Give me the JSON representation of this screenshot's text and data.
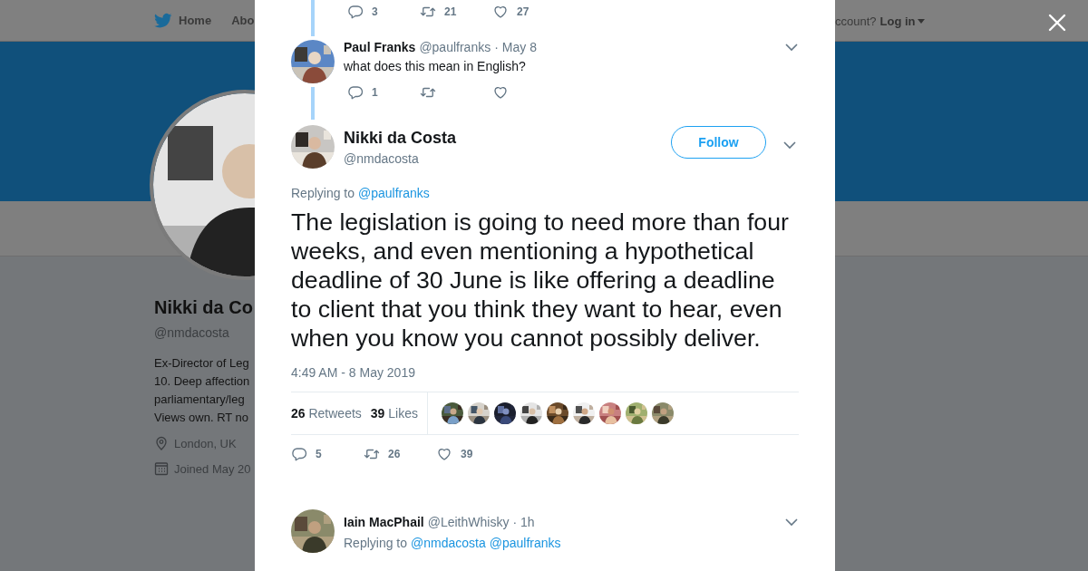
{
  "nav": {
    "items": [
      {
        "label": "Home",
        "kind": "home"
      },
      {
        "label": "Abo",
        "kind": "text"
      }
    ],
    "account_prompt": "ccount?",
    "login": "Log in"
  },
  "profile": {
    "name": "Nikki da Co",
    "handle": "@nmdacosta",
    "bio": [
      "Ex-Director of Leg",
      "10. Deep affection",
      "parliamentary/leg",
      "Views own. RT no"
    ],
    "location": "London, UK",
    "joined": "Joined May 20"
  },
  "thread": {
    "previous_actions": [
      {
        "kind": "reply",
        "count": "3"
      },
      {
        "kind": "retweet",
        "count": "21"
      },
      {
        "kind": "like",
        "count": "27"
      }
    ],
    "parent": {
      "name": "Paul Franks",
      "handle": "@paulfranks",
      "separator": "·",
      "time": "May 8",
      "text": "what does this mean in English?",
      "actions": [
        {
          "kind": "reply",
          "count": "1"
        },
        {
          "kind": "retweet"
        },
        {
          "kind": "like"
        }
      ]
    },
    "main": {
      "name": "Nikki da Costa",
      "handle": "@nmdacosta",
      "follow": "Follow",
      "replying_label": "Replying to",
      "replying_to": [
        "@paulfranks"
      ],
      "text": "The legislation is going to need more than four weeks, and even mentioning a hypothetical deadline of 30 June is like offering a deadline to client that you think they want to hear, even when you know you cannot possibly deliver.",
      "timestamp": "4:49 AM - 8 May 2019",
      "retweets": {
        "count": "26",
        "label": "Retweets"
      },
      "likes": {
        "count": "39",
        "label": "Likes"
      },
      "likers": [
        {
          "kind": "picture"
        },
        {
          "kind": "picture"
        },
        {
          "kind": "picture"
        },
        {
          "kind": "picture"
        },
        {
          "kind": "picture"
        },
        {
          "kind": "picture"
        },
        {
          "kind": "picture"
        },
        {
          "kind": "picture"
        },
        {
          "kind": "picture"
        }
      ],
      "actions": [
        {
          "kind": "reply",
          "count": "5"
        },
        {
          "kind": "retweet",
          "count": "26"
        },
        {
          "kind": "like",
          "count": "39"
        }
      ]
    },
    "reply": {
      "name": "Iain MacPhail",
      "handle": "@LeithWhisky",
      "separator": "·",
      "time": "1h",
      "replying_label": "Replying to",
      "replying_to": [
        "@nmdacosta",
        "@paulfranks"
      ]
    }
  }
}
